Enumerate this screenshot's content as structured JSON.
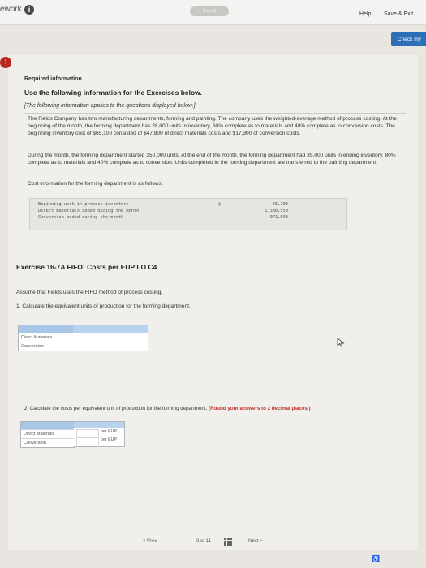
{
  "app": {
    "title": "ework",
    "saved": "Saved",
    "help": "Help",
    "save_exit": "Save & Exit",
    "check": "Check my"
  },
  "question": {
    "number": "!",
    "required_label": "Required information",
    "use_title": "Use the following information for the Exercises below.",
    "note": "[The following information applies to the questions displayed below.]",
    "paragraph1": "The Fields Company has two manufacturing departments, forming and painting. The company uses the weighted-average method of process costing. At the beginning of the month, the forming department has 28,000 units in inventory, 60% complete as to materials and 40% complete as to conversion costs. The beginning inventory cost of $65,100 consisted of $47,800 of direct materials costs and $17,300 of conversion costs.",
    "paragraph2": "During the month, the forming department started 350,000 units. At the end of the month, the forming department had 35,000 units in ending inventory, 80% complete as to materials and 40% complete as to conversion. Units completed in the forming department are transferred to the painting department.",
    "paragraph3": "Cost information for the forming department is as follows:",
    "costs": [
      {
        "label": "Beginning work in process inventory",
        "currency": "$",
        "amount": "65,100"
      },
      {
        "label": "Direct materials added during the month",
        "currency": "",
        "amount": "1,380,550"
      },
      {
        "label": "Conversion added during the month",
        "currency": "",
        "amount": "971,590"
      }
    ]
  },
  "exercise": {
    "title": "Exercise 16-7A FIFO: Costs per EUP LO C4",
    "assume": "Assume that Fields uses the FIFO method of process costing.",
    "q1": "1. Calculate the equivalent units of production for the forming department.",
    "q1_rows": [
      "Direct Materials",
      "Conversion"
    ],
    "q2_text": "2. Calculate the costs per equivalent unit of production for the forming department.",
    "q2_hint": "(Round your answers to 2 decimal places.)",
    "q2_rows": [
      "Direct Materials",
      "Conversion"
    ],
    "q2_unit": "per EUP"
  },
  "pager": {
    "prev": "Prev",
    "page": "3 of 11",
    "next": "Next"
  }
}
